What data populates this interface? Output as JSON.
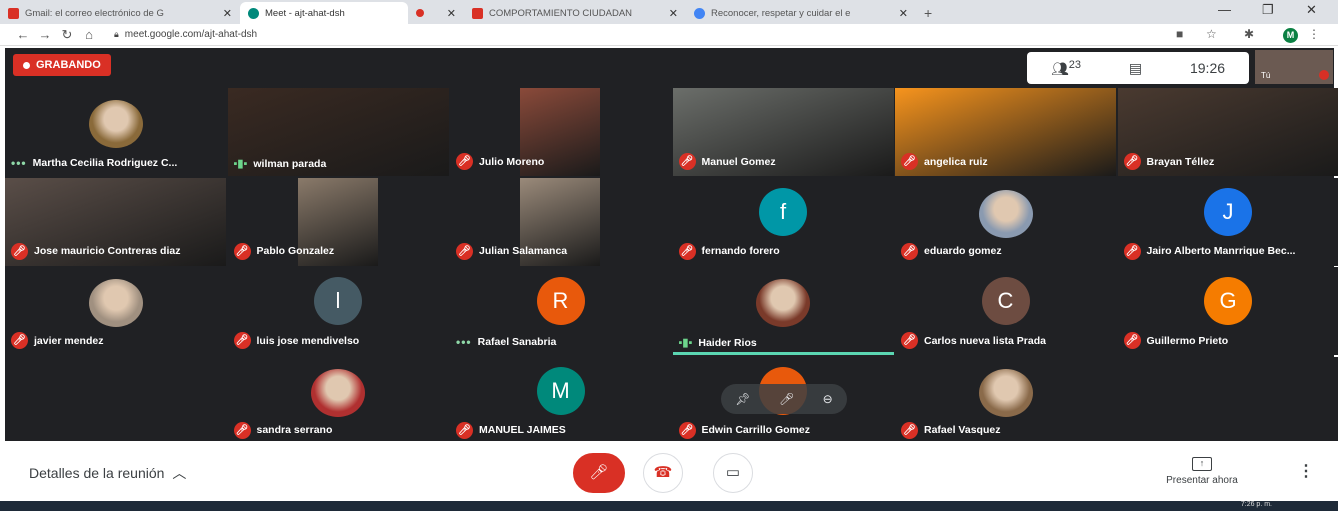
{
  "browser": {
    "tabs": [
      {
        "title": "Gmail: el correo electrónico de G",
        "icon": "gmail-icon",
        "color": "#d93025",
        "active": false
      },
      {
        "title": "Meet - ajt-ahat-dsh",
        "icon": "meet-icon",
        "color": "#00897b",
        "active": true
      },
      {
        "title": "",
        "icon": "recording-icon",
        "color": "#d93025",
        "active": false
      },
      {
        "title": "COMPORTAMIENTO CIUDADAN",
        "icon": "k-icon",
        "color": "#d93025",
        "active": false
      },
      {
        "title": "Reconocer, respetar y cuidar el e",
        "icon": "google-icon",
        "color": "#4285f4",
        "active": false
      }
    ],
    "new_tab": "+",
    "url": "meet.google.com/ajt-ahat-dsh",
    "profile_initial": "M"
  },
  "meet": {
    "recording_label": "GRABANDO",
    "participants_count": "23",
    "time": "19:26",
    "self_label": "Tú",
    "tiles": [
      {
        "name": "Martha Cecilia Rodriguez C...",
        "status": "dots",
        "kind": "photo",
        "color": "#8a6a3a"
      },
      {
        "name": "wilman parada",
        "status": "wave",
        "kind": "video",
        "color": "#3a2a22"
      },
      {
        "name": "Julio Moreno",
        "status": "muted",
        "kind": "video",
        "color": "#8a4a3a"
      },
      {
        "name": "Manuel Gomez",
        "status": "muted",
        "kind": "video",
        "color": "#6b6e6a"
      },
      {
        "name": "angelica ruiz",
        "status": "muted",
        "kind": "video",
        "color": "#f7941d"
      },
      {
        "name": "Brayan Téllez",
        "status": "muted",
        "kind": "video",
        "color": "#4a3a30"
      },
      {
        "name": "Jose mauricio Contreras diaz",
        "status": "muted",
        "kind": "video",
        "color": "#5a4e48"
      },
      {
        "name": "Pablo Gonzalez",
        "status": "muted",
        "kind": "video",
        "color": "#8a7a6a"
      },
      {
        "name": "Julian Salamanca",
        "status": "muted",
        "kind": "video",
        "color": "#9a8a7a"
      },
      {
        "name": "fernando forero",
        "status": "muted",
        "kind": "letter",
        "letter": "f",
        "color": "#0097a7"
      },
      {
        "name": "eduardo gomez",
        "status": "muted",
        "kind": "photo",
        "color": "#8a9ab0"
      },
      {
        "name": "Jairo Alberto Manrrique Bec...",
        "status": "muted",
        "kind": "letter",
        "letter": "J",
        "color": "#1a73e8"
      },
      {
        "name": "javier mendez",
        "status": "muted",
        "kind": "photo",
        "color": "#a09080"
      },
      {
        "name": "luis jose mendivelso",
        "status": "muted",
        "kind": "letter",
        "letter": "l",
        "color": "#455a64"
      },
      {
        "name": "Rafael Sanabria",
        "status": "dots",
        "kind": "letter",
        "letter": "R",
        "color": "#e8590c"
      },
      {
        "name": "Haider Rios",
        "status": "wave",
        "kind": "photo",
        "color": "#7a3a2a",
        "active": true
      },
      {
        "name": "Carlos nueva lista Prada",
        "status": "muted",
        "kind": "letter",
        "letter": "C",
        "color": "#6d4c41"
      },
      {
        "name": "Guillermo Prieto",
        "status": "muted",
        "kind": "letter",
        "letter": "G",
        "color": "#f57c00"
      },
      {
        "name": "",
        "status": "none",
        "kind": "empty",
        "color": "#202124"
      },
      {
        "name": "sandra serrano",
        "status": "muted",
        "kind": "photo",
        "color": "#b03030"
      },
      {
        "name": "MANUEL JAIMES",
        "status": "muted",
        "kind": "letter",
        "letter": "M",
        "color": "#00897b"
      },
      {
        "name": "Edwin Carrillo Gomez",
        "status": "muted",
        "kind": "letter",
        "letter": "",
        "color": "#e8590c"
      },
      {
        "name": "Rafael Vasquez",
        "status": "muted",
        "kind": "photo",
        "color": "#8a6a4a"
      },
      {
        "name": "",
        "status": "none",
        "kind": "empty",
        "color": "#202124"
      }
    ]
  },
  "bottom": {
    "details_label": "Detalles de la reunión",
    "present_label": "Presentar ahora"
  },
  "taskbar": {
    "clock": "7:26 p. m."
  }
}
